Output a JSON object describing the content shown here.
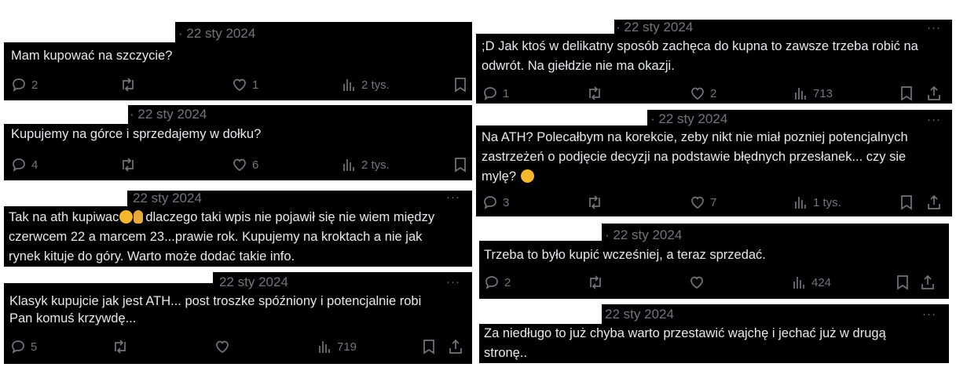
{
  "tweets": [
    {
      "date": "· 22 sty 2024",
      "text": "Mam kupować na szczycie?",
      "replies": "2",
      "likes": "1",
      "views": "2 tys."
    },
    {
      "date": "· 22 sty 2024",
      "text": "Kupujemy na górce i sprzedajemy w dołku?",
      "replies": "4",
      "likes": "6",
      "views": "2 tys."
    },
    {
      "date": "22 sty 2024",
      "line1a": "Tak na ath kupiwac",
      "line1b": "dlaczego taki wpis nie pojawił się nie wiem między",
      "line2": "czerwcem 22 a marcem 23...prawie rok. Kupujemy na kroktach a nie jak",
      "line3": "rynek kituje do góry. Warto może dodać takie info."
    },
    {
      "date": "22 sty 2024",
      "line1": "Klasyk kupujcie jak jest ATH... post troszke spóźniony i potencjalnie robi",
      "line2": "Pan komuś krzywdę...",
      "replies": "5",
      "views": "719"
    },
    {
      "date": "· 22 sty 2024",
      "line1": ";D Jak ktoś w delikatny sposób zachęca do kupna to zawsze trzeba robić na",
      "line2": "odwrót. Na giełdzie nie ma okazji.",
      "replies": "1",
      "likes": "2",
      "views": "713"
    },
    {
      "date": "· 22 sty 2024",
      "line1": "Na ATH? Polecałbym na korekcie, zeby nikt nie miał pozniej potencjalnych",
      "line2": "zastrzeżeń o podjęcie decyzji na podstawie błędnych przesłanek... czy sie",
      "line3": "mylę?",
      "replies": "3",
      "likes": "7",
      "views": "1 tys."
    },
    {
      "date": "· 22 sty 2024",
      "text": "Trzeba to było kupić wcześniej, a teraz sprzedać.",
      "replies": "2",
      "views": "424"
    },
    {
      "date": "22 sty 2024",
      "line1": "Za niedługo to już chyba warto przestawić wajchę i jechać już w drugą",
      "line2": "stronę.."
    }
  ],
  "more_label": "···",
  "icons": {
    "reply": "reply-icon",
    "retweet": "retweet-icon",
    "like": "heart-icon",
    "views": "views-icon",
    "bookmark": "bookmark-icon",
    "share": "share-icon"
  }
}
